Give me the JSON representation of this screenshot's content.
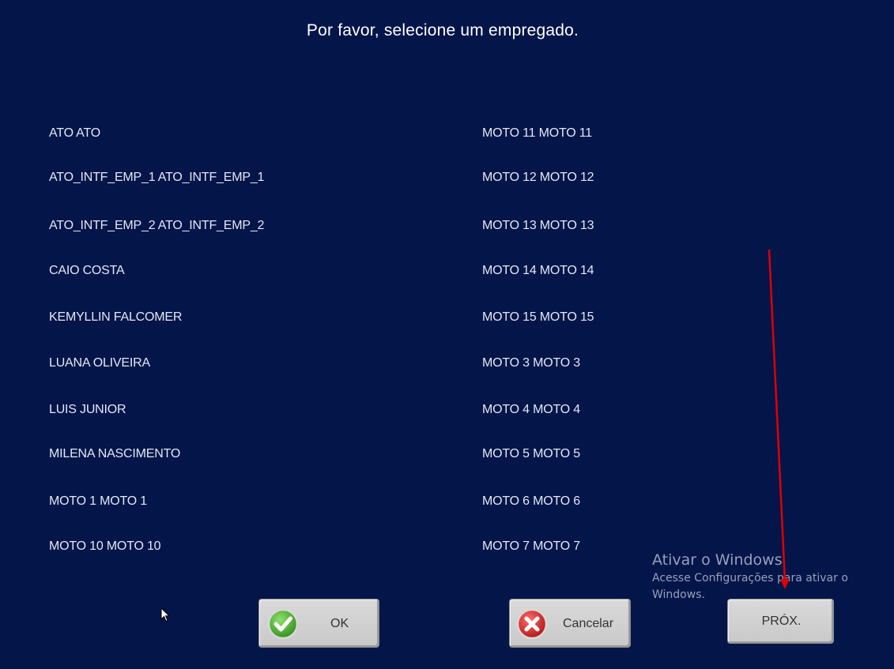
{
  "prompt": "Por favor, selecione um empregado.",
  "employees_left": [
    "ATO ATO",
    "ATO_INTF_EMP_1 ATO_INTF_EMP_1",
    "ATO_INTF_EMP_2 ATO_INTF_EMP_2",
    "CAIO COSTA",
    "KEMYLLIN FALCOMER",
    "LUANA OLIVEIRA",
    "LUIS JUNIOR",
    "MILENA NASCIMENTO",
    "MOTO 1 MOTO 1",
    "MOTO 10 MOTO 10"
  ],
  "employees_right": [
    "MOTO 11 MOTO 11",
    "MOTO 12 MOTO 12",
    "MOTO 13 MOTO 13",
    "MOTO 14 MOTO 14",
    "MOTO 15 MOTO 15",
    "MOTO 3 MOTO 3",
    "MOTO 4 MOTO 4",
    "MOTO 5 MOTO 5",
    "MOTO 6 MOTO 6",
    "MOTO 7 MOTO 7"
  ],
  "buttons": {
    "ok_label": "OK",
    "ok_icon": "checkmark-icon",
    "cancel_label": "Cancelar",
    "cancel_icon": "x-circle-icon",
    "next_label": "PRÓX."
  },
  "watermark": {
    "title": "Ativar o Windows",
    "subtitle": "Acesse Configurações para ativar o Windows."
  },
  "colors": {
    "background": "#04154a",
    "annotation_arrow": "#e00000"
  }
}
